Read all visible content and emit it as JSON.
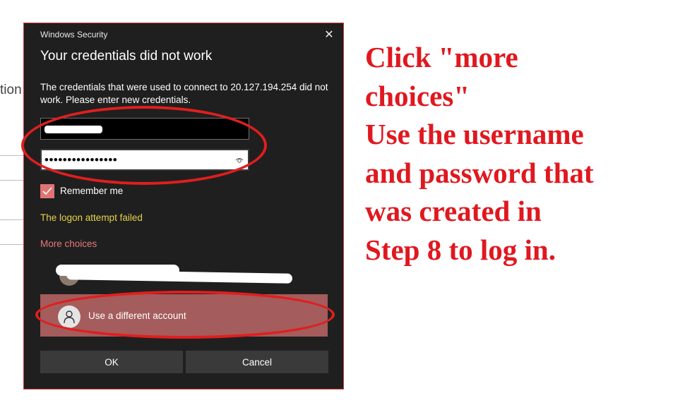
{
  "background": {
    "partial_text": "tion"
  },
  "dialog": {
    "title": "Windows Security",
    "close_glyph": "✕",
    "heading": "Your credentials did not work",
    "message": "The credentials that were used to connect to 20.127.194.254 did not work. Please enter new credentials.",
    "password_value": "••••••••••••••••",
    "remember_label": "Remember me",
    "remember_checked": true,
    "error_text": "The logon attempt failed",
    "more_choices_label": "More choices",
    "different_account_label": "Use a different account",
    "ok_label": "OK",
    "cancel_label": "Cancel"
  },
  "annotation": {
    "lines": [
      "Click \"more",
      "choices\"",
      "Use the username",
      "and password that",
      "was created in",
      "Step 8 to log in."
    ],
    "color": "#e0181f"
  },
  "colors": {
    "dialog_bg": "#1f1f1f",
    "accent_pink": "#e87878",
    "warning_yellow": "#e6d34a",
    "selected_account": "#a45c5c",
    "annotation_red": "#e01e1e"
  }
}
